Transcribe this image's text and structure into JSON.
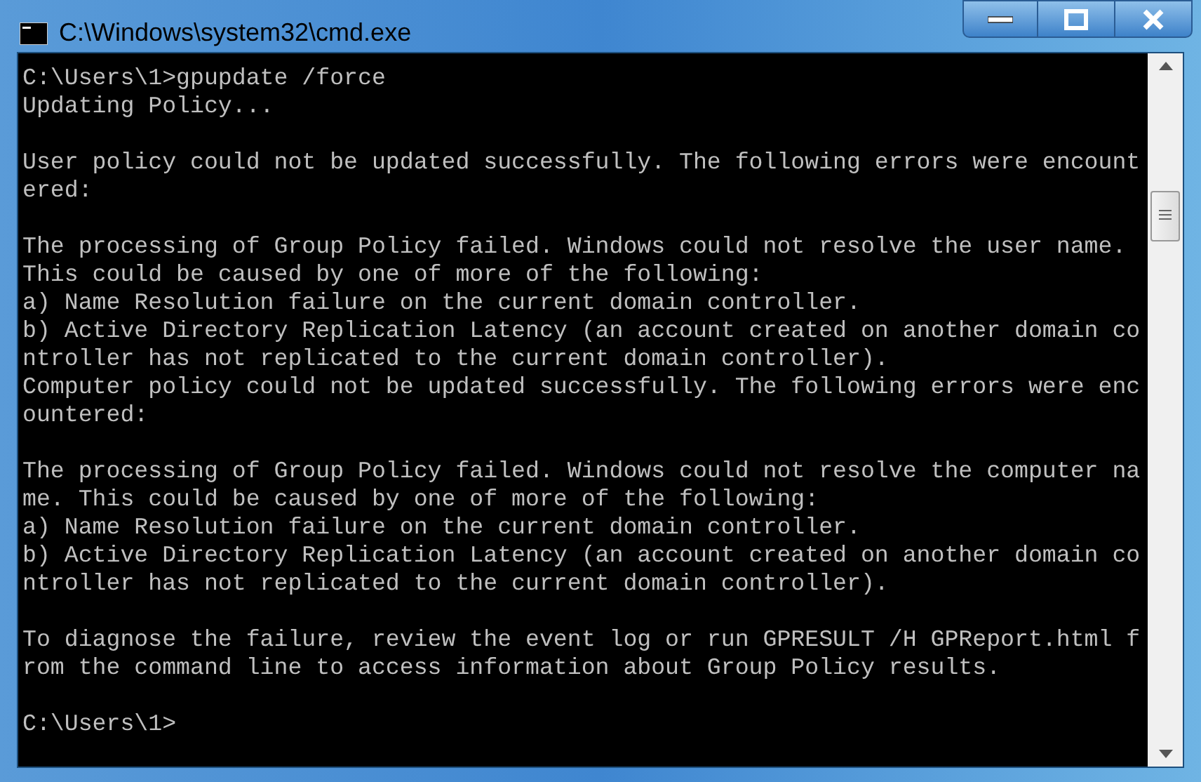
{
  "window": {
    "title": "C:\\Windows\\system32\\cmd.exe"
  },
  "console": {
    "blocks": [
      [
        "C:\\Users\\1>gpupdate /force",
        "Updating Policy..."
      ],
      [
        "User policy could not be updated successfully. The following errors were encount",
        "ered:"
      ],
      [
        "The processing of Group Policy failed. Windows could not resolve the user name.",
        "This could be caused by one of more of the following:",
        "a) Name Resolution failure on the current domain controller.",
        "b) Active Directory Replication Latency (an account created on another domain co",
        "ntroller has not replicated to the current domain controller).",
        "Computer policy could not be updated successfully. The following errors were enc",
        "ountered:"
      ],
      [
        "The processing of Group Policy failed. Windows could not resolve the computer na",
        "me. This could be caused by one of more of the following:",
        "a) Name Resolution failure on the current domain controller.",
        "b) Active Directory Replication Latency (an account created on another domain co",
        "ntroller has not replicated to the current domain controller)."
      ],
      [
        "To diagnose the failure, review the event log or run GPRESULT /H GPReport.html f",
        "rom the command line to access information about Group Policy results."
      ],
      [
        "C:\\Users\\1>"
      ]
    ]
  }
}
